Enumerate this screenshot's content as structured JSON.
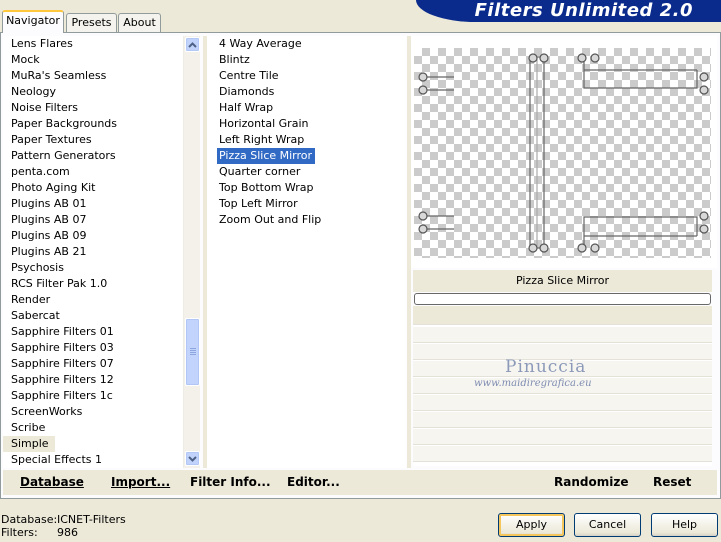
{
  "app_title": "Filters Unlimited 2.0",
  "tabs": [
    {
      "label": "Navigator",
      "active": true
    },
    {
      "label": "Presets",
      "active": false
    },
    {
      "label": "About",
      "active": false
    }
  ],
  "categories": {
    "items": [
      "Lens Flares",
      "Mock",
      "MuRa's Seamless",
      "Neology",
      "Noise Filters",
      "Paper Backgrounds",
      "Paper Textures",
      "Pattern Generators",
      "penta.com",
      "Photo Aging Kit",
      "Plugins AB 01",
      "Plugins AB 07",
      "Plugins AB 09",
      "Plugins AB 21",
      "Psychosis",
      "RCS Filter Pak 1.0",
      "Render",
      "Sabercat",
      "Sapphire Filters 01",
      "Sapphire Filters 03",
      "Sapphire Filters 07",
      "Sapphire Filters 12",
      "Sapphire Filters 1c",
      "ScreenWorks",
      "Scribe",
      "Simple",
      "Special Effects 1"
    ],
    "selected": "Simple"
  },
  "filters": {
    "items": [
      "4 Way Average",
      "Blintz",
      "Centre Tile",
      "Diamonds",
      "Half Wrap",
      "Horizontal Grain",
      "Left Right Wrap",
      "Pizza Slice Mirror",
      "Quarter corner",
      "Top Bottom Wrap",
      "Top Left Mirror",
      "Zoom Out and Flip"
    ],
    "selected": "Pizza Slice Mirror"
  },
  "preview": {
    "filter_name": "Pizza Slice Mirror",
    "progress": 0
  },
  "watermark": {
    "name": "Pinuccia",
    "url": "www.maidiregrafica.eu"
  },
  "bottom_buttons": {
    "database": "Database",
    "import": "Import...",
    "filter_info": "Filter Info...",
    "editor": "Editor...",
    "randomize": "Randomize",
    "reset": "Reset"
  },
  "info": {
    "database_label": "Database:",
    "database_value": "ICNET-Filters",
    "filters_label": "Filters:",
    "filters_value": "986"
  },
  "dialog_buttons": {
    "apply": "Apply",
    "cancel": "Cancel",
    "help": "Help"
  },
  "colors": {
    "banner": "#0a2b8c",
    "selection": "#316ac5",
    "face": "#ece9d8"
  }
}
